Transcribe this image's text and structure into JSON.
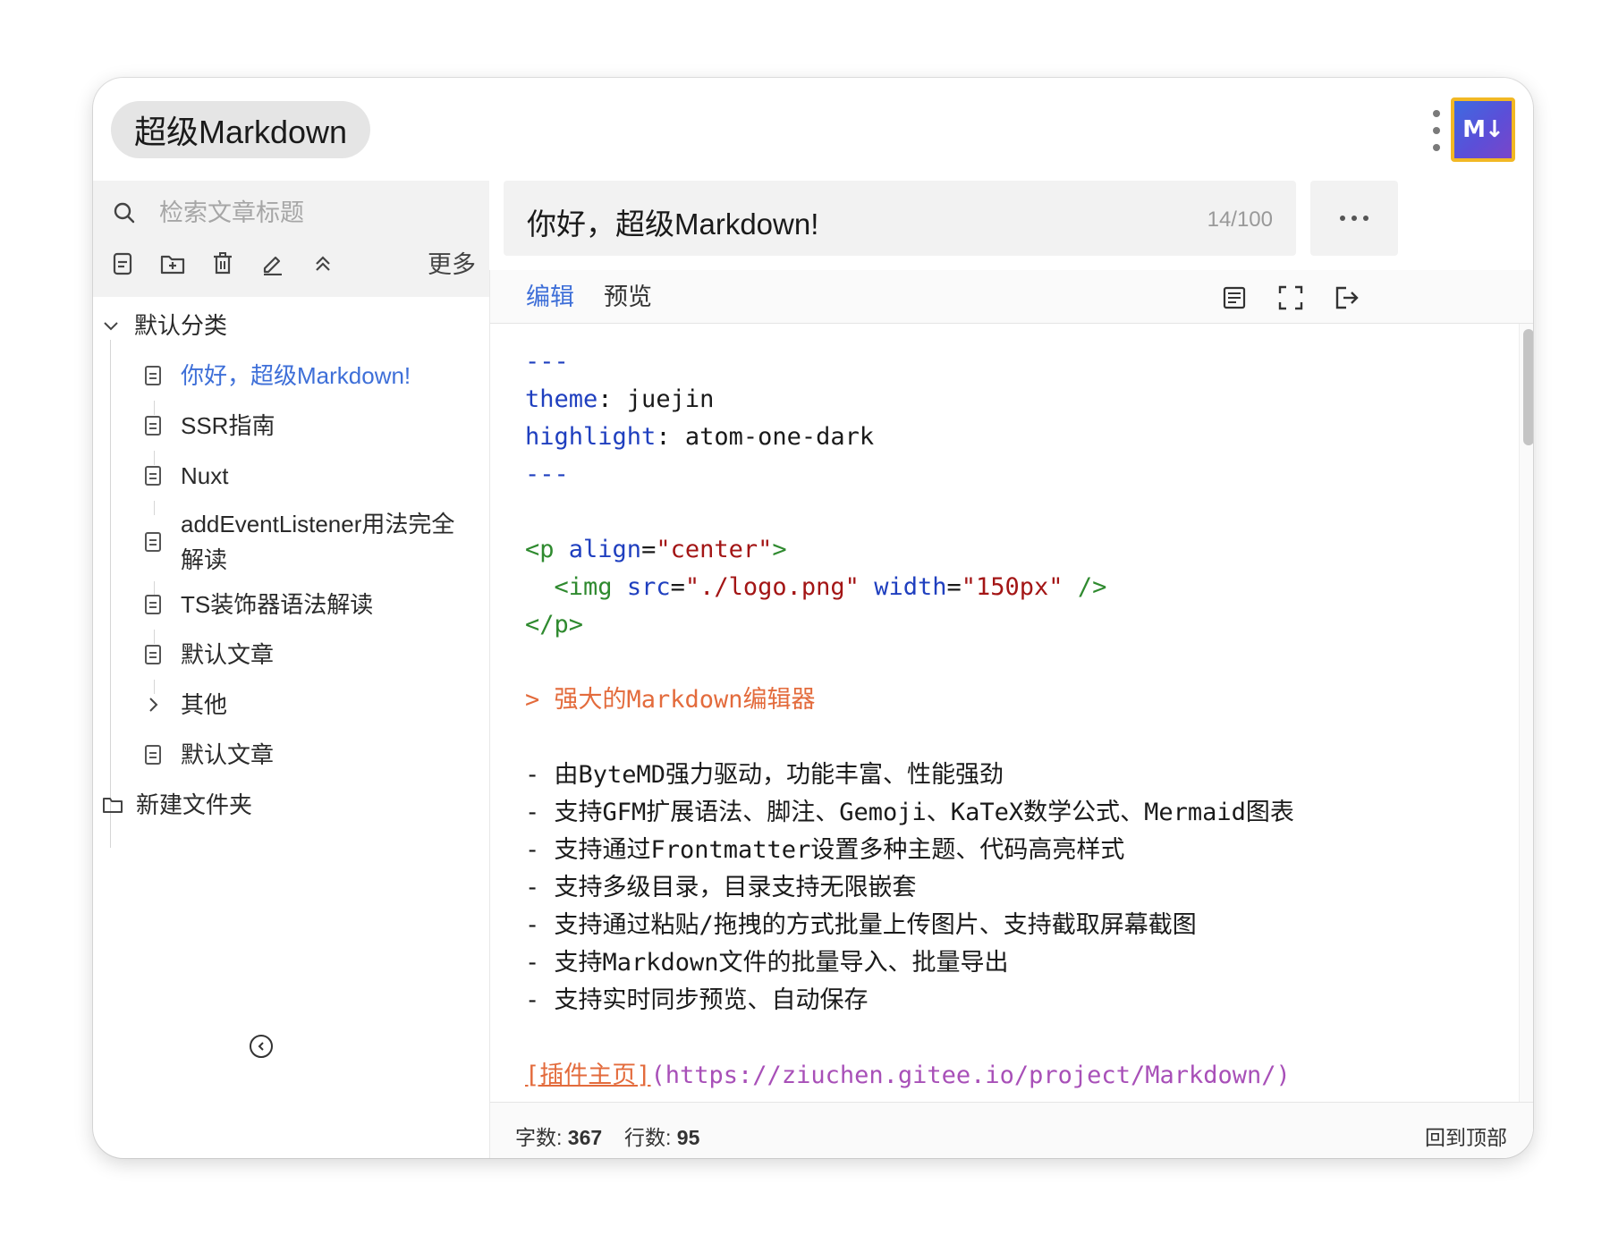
{
  "app": {
    "title": "超级Markdown",
    "logo_text": "M↓"
  },
  "sidebar": {
    "search_placeholder": "检索文章标题",
    "tools": [
      "new-file-icon",
      "new-folder-icon",
      "delete-icon",
      "rename-icon",
      "collapse-all-icon"
    ],
    "more_label": "更多",
    "tree": {
      "root_label": "默认分类",
      "items": [
        {
          "label": "你好，超级Markdown!",
          "type": "file",
          "active": true
        },
        {
          "label": "SSR指南",
          "type": "file"
        },
        {
          "label": "Nuxt",
          "type": "file"
        },
        {
          "label": "addEventListener用法完全",
          "label2": "解读",
          "type": "file"
        },
        {
          "label": "TS装饰器语法解读",
          "type": "file"
        },
        {
          "label": "默认文章",
          "type": "file"
        },
        {
          "label": "其他",
          "type": "folder-collapsed"
        },
        {
          "label": "默认文章",
          "type": "file"
        }
      ],
      "new_folder_label": "新建文件夹"
    }
  },
  "document": {
    "title": "你好，超级Markdown!",
    "counter": "14/100"
  },
  "editor": {
    "tabs": {
      "edit": "编辑",
      "preview": "预览"
    },
    "code": {
      "l1": "---",
      "l2_key": "theme",
      "l2_val": " juejin",
      "l3_key": "highlight",
      "l3_val": " atom-one-dark",
      "l4": "---",
      "l6_tag": "<p",
      "l6_attr": "align",
      "l6_str": "\"center\"",
      "l6_end": ">",
      "l7_tag": "<img",
      "l7_attr1": "src",
      "l7_str1": "\"./logo.png\"",
      "l7_attr2": "width",
      "l7_str2": "\"150px\"",
      "l7_end": "/>",
      "l8_tag": "</p>",
      "l10": "> 强大的Markdown编辑器",
      "list": [
        "- 由ByteMD强力驱动，功能丰富、性能强劲",
        "- 支持GFM扩展语法、脚注、Gemoji、KaTeX数学公式、Mermaid图表",
        "- 支持通过Frontmatter设置多种主题、代码高亮样式",
        "- 支持多级目录，目录支持无限嵌套",
        "- 支持通过粘贴/拖拽的方式批量上传图片、支持截取屏幕截图",
        "- 支持Markdown文件的批量导入、批量导出",
        "- 支持实时同步预览、自动保存"
      ],
      "link_text": "[插件主页]",
      "link_url": "(https://ziuchen.gitee.io/project/Markdown/)"
    },
    "status": {
      "chars_label": "字数:",
      "chars_value": "367",
      "lines_label": "行数:",
      "lines_value": "95",
      "back_to_top": "回到顶部"
    }
  },
  "colors": {
    "accent": "#3e6fd8",
    "yaml_key": "#1f3fbf",
    "html_tag": "#2f8a2f",
    "string": "#a31515",
    "quote": "#e36b3c",
    "url": "#a850b8"
  }
}
